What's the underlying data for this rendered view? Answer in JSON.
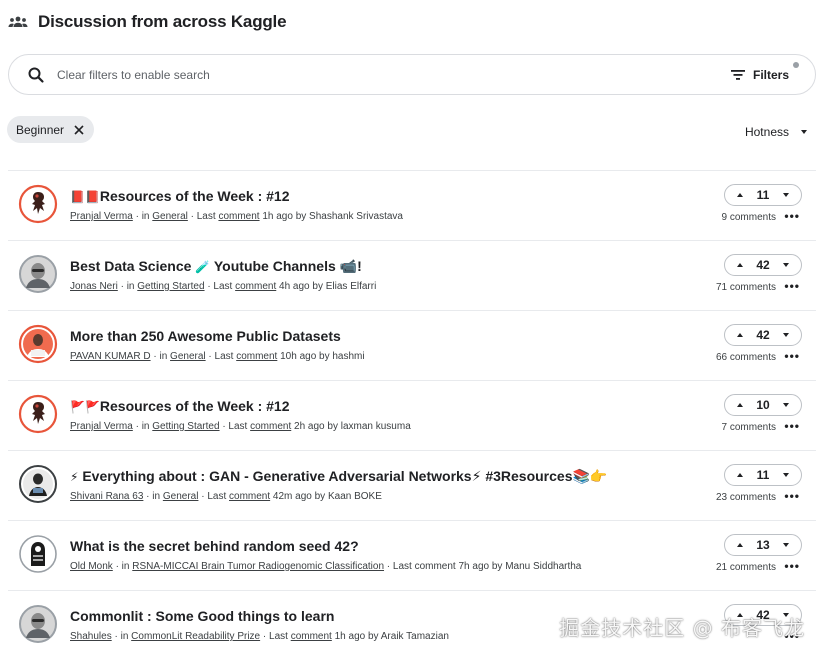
{
  "header": {
    "title": "Discussion from across Kaggle",
    "icon": "people-icon"
  },
  "search": {
    "placeholder": "Clear filters to enable search",
    "filters_label": "Filters"
  },
  "chip": {
    "label": "Beginner"
  },
  "sort": {
    "label": "Hotness"
  },
  "colors": {
    "accent": "#e8553a",
    "border": "#dadce0",
    "chip_bg": "#e8eaed"
  },
  "discussions": [
    {
      "title": "Resources of the Week : #12",
      "lead": "📕📕",
      "trail": "",
      "author": "Pranjal Verma",
      "in_text": "· in",
      "forum": "General",
      "sep": "· Last",
      "comment_word": "comment",
      "tail": "1h ago by Shashank Srivastava",
      "votes": "11",
      "comments": "9 comments",
      "avatar": "accent-figure"
    },
    {
      "title": "Best Data Science ",
      "lead": "",
      "mid": "🧪",
      "title2": " Youtube Channels ",
      "trail": "📹!",
      "author": "Jonas Neri",
      "in_text": "· in",
      "forum": "Getting Started",
      "sep": "· Last",
      "comment_word": "comment",
      "tail": "4h ago by Elias Elfarri",
      "votes": "42",
      "comments": "71 comments",
      "avatar": "gray-face"
    },
    {
      "title": "More than 250 Awesome Public Datasets",
      "lead": "",
      "trail": "",
      "author": "PAVAN KUMAR D",
      "in_text": "· in",
      "forum": "General",
      "sep": "· Last",
      "comment_word": "comment",
      "tail": "10h ago by hashmi",
      "votes": "42",
      "comments": "66 comments",
      "avatar": "red-person"
    },
    {
      "title": "Resources of the Week : #12",
      "lead": "🚩🚩",
      "trail": "",
      "author": "Pranjal Verma",
      "in_text": "· in",
      "forum": "Getting Started",
      "sep": "· Last",
      "comment_word": "comment",
      "tail": "2h ago by laxman kusuma",
      "votes": "10",
      "comments": "7 comments",
      "avatar": "accent-figure"
    },
    {
      "title": " Everything about : GAN - Generative Adversarial Networks",
      "lead": "⚡",
      "trail": "⚡ #3Resources📚👉",
      "author": "Shivani Rana 63",
      "in_text": "· in",
      "forum": "General",
      "sep": "· Last",
      "comment_word": "comment",
      "tail": "42m ago by Kaan BOKE",
      "votes": "11",
      "comments": "23 comments",
      "avatar": "dark-figure"
    },
    {
      "title": "What is the secret behind random seed 42?",
      "lead": "",
      "trail": "",
      "author": "Old Monk",
      "in_text": "· in",
      "forum": "RSNA-MICCAI Brain Tumor Radiogenomic Classification",
      "sep": "· Last comment",
      "comment_word": "",
      "tail": "7h ago by Manu Siddhartha",
      "votes": "13",
      "comments": "21 comments",
      "avatar": "outline-head"
    },
    {
      "title": "Commonlit : Some Good things to learn",
      "lead": "",
      "trail": "",
      "author": "Shahules",
      "in_text": "· in",
      "forum": "CommonLit Readability Prize",
      "sep": "· Last",
      "comment_word": "comment",
      "tail": "1h ago by Araik Tamazian",
      "votes": "42",
      "comments": "",
      "avatar": "gray-face"
    }
  ],
  "watermark": "掘金技术社区 @ 布客飞龙"
}
